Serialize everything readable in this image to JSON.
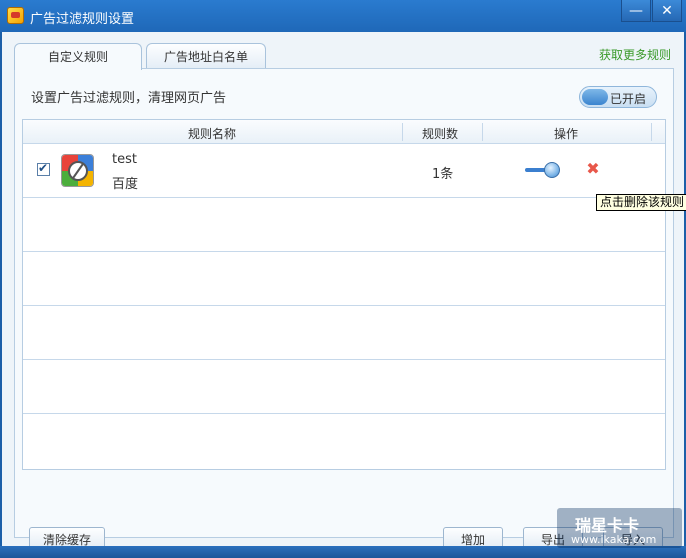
{
  "window": {
    "title": "广告过滤规则设置",
    "minimize_glyph": "—",
    "close_glyph": "✕"
  },
  "tabs": [
    {
      "label": "自定义规则",
      "active": true
    },
    {
      "label": "广告地址白名单",
      "active": false
    }
  ],
  "more_rules_link": "获取更多规则",
  "description": "设置广告过滤规则，清理网页广告",
  "toggle": {
    "label": "已开启",
    "on": true
  },
  "table": {
    "headers": {
      "name": "规则名称",
      "count": "规则数",
      "ops": "操作"
    },
    "rows": [
      {
        "checked": true,
        "name": "test",
        "source": "百度",
        "count": "1条",
        "enabled": true
      }
    ]
  },
  "tooltip": "点击删除该规则",
  "buttons": {
    "clear_cache": "清除缓存",
    "add": "增加",
    "export": "导出",
    "import": "导入"
  },
  "watermark": {
    "brand": "瑞星卡卡",
    "url": "www.ikaka.com"
  },
  "colors": {
    "titlebar": "#1f68b8",
    "accent_link": "#3a9a2a",
    "delete": "#e8574a"
  }
}
